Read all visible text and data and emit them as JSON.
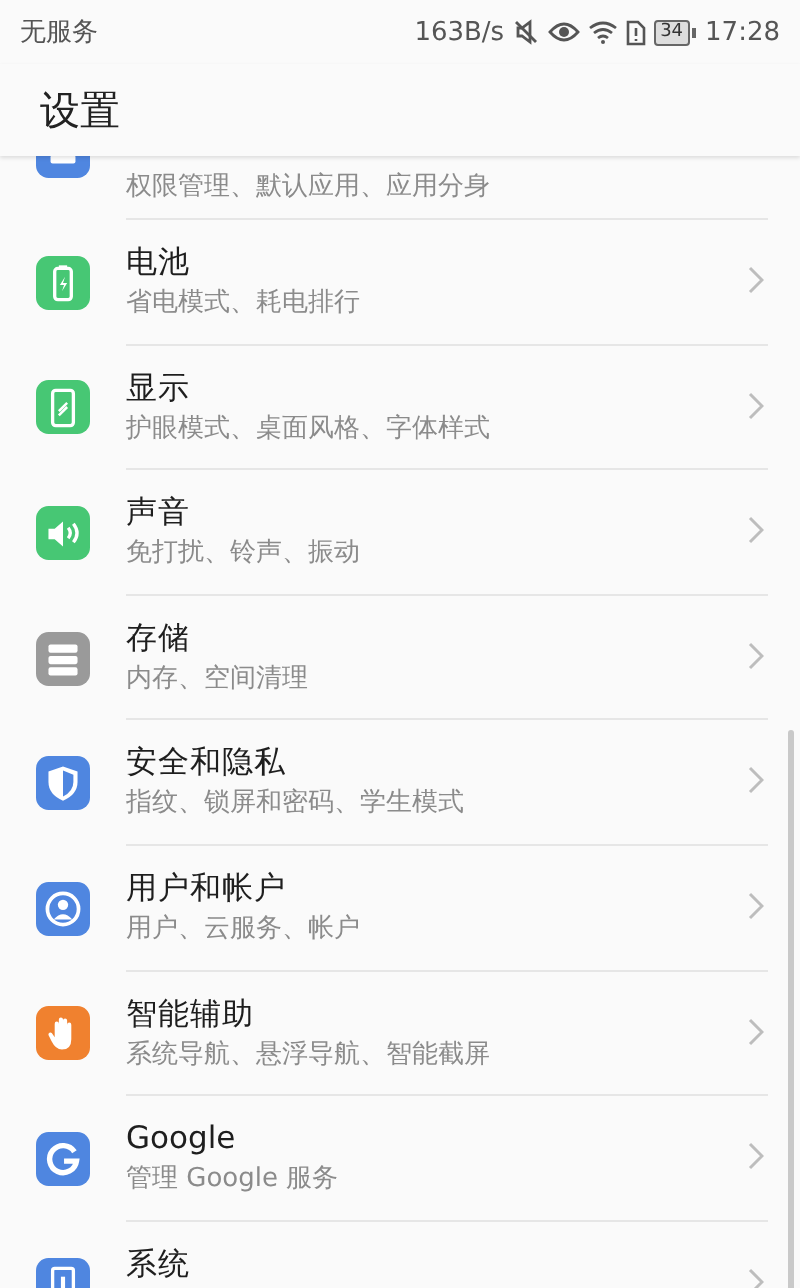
{
  "status_bar": {
    "carrier": "无服务",
    "speed": "163B/s",
    "battery": "34",
    "time": "17:28"
  },
  "header": {
    "title": "设置"
  },
  "items": [
    {
      "kind": "apps",
      "color": "#4f86e0",
      "subtitle": "权限管理、默认应用、应用分身"
    },
    {
      "kind": "battery",
      "color": "#47c774",
      "title": "电池",
      "subtitle": "省电模式、耗电排行"
    },
    {
      "kind": "display",
      "color": "#47c774",
      "title": "显示",
      "subtitle": "护眼模式、桌面风格、字体样式"
    },
    {
      "kind": "sound",
      "color": "#47c774",
      "title": "声音",
      "subtitle": "免打扰、铃声、振动"
    },
    {
      "kind": "storage",
      "color": "#9a9a9a",
      "title": "存储",
      "subtitle": "内存、空间清理"
    },
    {
      "kind": "security",
      "color": "#4f86e0",
      "title": "安全和隐私",
      "subtitle": "指纹、锁屏和密码、学生模式"
    },
    {
      "kind": "account",
      "color": "#4f86e0",
      "title": "用户和帐户",
      "subtitle": "用户、云服务、帐户"
    },
    {
      "kind": "assist",
      "color": "#f0812f",
      "title": "智能辅助",
      "subtitle": "系统导航、悬浮导航、智能截屏"
    },
    {
      "kind": "google",
      "color": "#4f86e0",
      "title": "Google",
      "subtitle": "管理 Google 服务"
    },
    {
      "kind": "system",
      "color": "#4f86e0",
      "title": "系统"
    }
  ]
}
